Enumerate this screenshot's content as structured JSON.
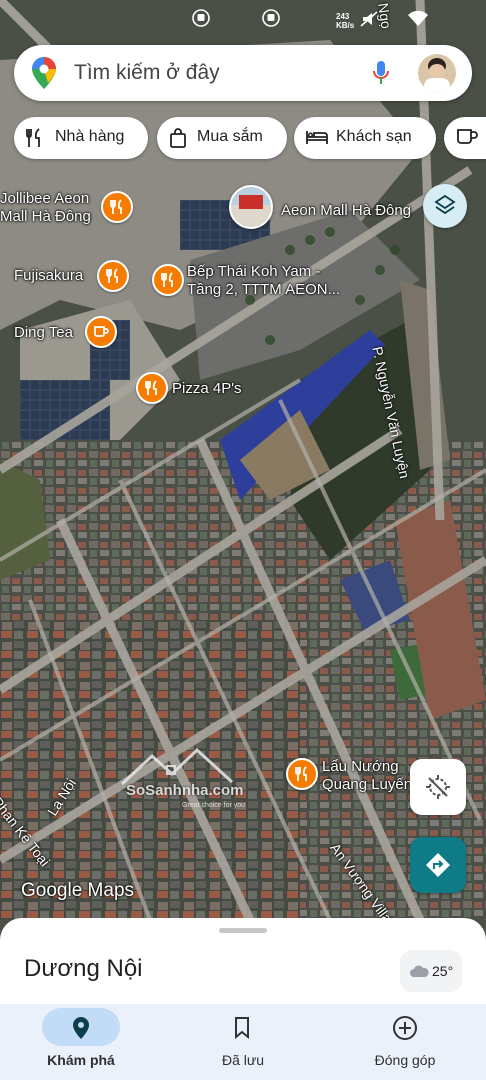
{
  "status_bar": {
    "network_speed": "243",
    "network_speed_unit": "KB/s"
  },
  "search": {
    "placeholder": "Tìm kiếm ở đây"
  },
  "chips": [
    {
      "label": "Nhà hàng",
      "icon": "fork-knife-icon"
    },
    {
      "label": "Mua sắm",
      "icon": "shopping-bag-icon"
    },
    {
      "label": "Khách sạn",
      "icon": "bed-icon"
    },
    {
      "label": "",
      "icon": "coffee-cup-icon"
    }
  ],
  "map": {
    "pois": [
      {
        "name": "Jollibee Aeon Mall Hà Đông",
        "icon": "restaurant-icon"
      },
      {
        "name": "Aeon Mall Hà Đông",
        "icon": "mall-photo-icon"
      },
      {
        "name": "Fujisakura",
        "icon": "restaurant-icon"
      },
      {
        "name": "Bếp Thái Koh Yam - Tầng 2, TTTM AEON...",
        "icon": "restaurant-icon"
      },
      {
        "name": "Ding Tea",
        "icon": "coffee-icon"
      },
      {
        "name": "Pizza 4P's",
        "icon": "restaurant-icon"
      },
      {
        "name": "Lẩu Nướng Quang Luyến",
        "icon": "restaurant-icon"
      }
    ],
    "streets": [
      "P. Nguyễn Văn Luyện",
      "La Nội",
      "Phan Kế Toại",
      "An Vượng Villa",
      "Ngọ"
    ],
    "watermark": "SoSanhnha.com",
    "watermark_tagline": "Great choice for you",
    "attribution": "Google Maps"
  },
  "sheet": {
    "place_name": "Dương Nội",
    "temperature": "25°"
  },
  "bottom_nav": [
    {
      "label": "Khám phá",
      "icon": "explore-pin-icon",
      "active": true
    },
    {
      "label": "Đã lưu",
      "icon": "bookmark-icon",
      "active": false
    },
    {
      "label": "Đóng góp",
      "icon": "add-circle-icon",
      "active": false
    }
  ],
  "colors": {
    "poi_orange": "#f57c00",
    "accent_teal": "#0f7b86",
    "nav_active": "#c2dcf7",
    "nav_background": "#eaf1fb"
  }
}
